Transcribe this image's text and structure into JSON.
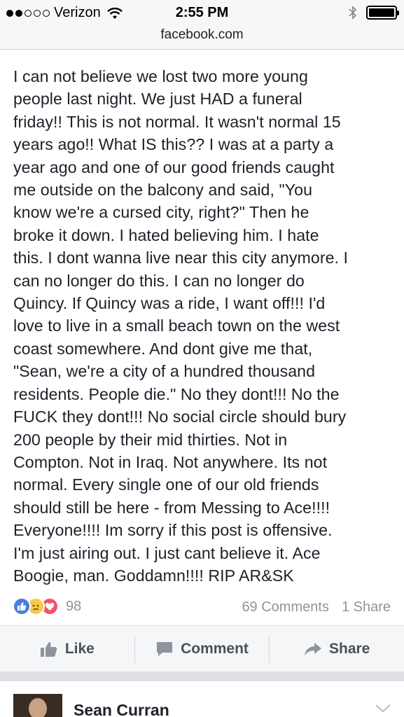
{
  "status_bar": {
    "carrier": "Verizon",
    "time": "2:55 PM",
    "signal_bars_filled": 2,
    "signal_bars_total": 5,
    "battery_level": 1.0
  },
  "browser": {
    "url": "facebook.com"
  },
  "post": {
    "text": "I can not believe we lost two more young\npeople last night. We just HAD a funeral\nfriday!! This is not normal. It wasn't normal 15\nyears ago!! What IS this?? I was at a party a\nyear ago and one of our good friends caught\nme outside on the balcony and said, \"You\nknow we're a cursed city, right?\" Then he\nbroke it down. I hated believing him. I hate\nthis. I dont wanna live near this city anymore. I\ncan no longer do this. I can no longer do\nQuincy. If Quincy was a ride, I want off!!! I'd\nlove to live in a small beach town on the west\ncoast somewhere. And dont give me that,\n\"Sean, we're a city of a hundred thousand\nresidents. People die.\" No they dont!!! No the\nFUCK they dont!!! No social circle should bury\n200 people by their mid thirties. Not in\nCompton. Not in Iraq. Not anywhere. Its not\nnormal. Every single one of our old friends\nshould still be here - from Messing to Ace!!!!\nEveryone!!!! Im sorry if this post is offensive.\nI'm just airing out. I just cant believe it. Ace\nBoogie, man. Goddamn!!!! RIP AR&SK",
    "reaction_icons": [
      "like-icon",
      "sad-icon",
      "love-icon"
    ],
    "reaction_count": "98",
    "comments": "69 Comments",
    "shares": "1 Share"
  },
  "actions": {
    "like": "Like",
    "comment": "Comment",
    "share": "Share"
  },
  "next_post": {
    "author": "Sean Curran"
  },
  "colors": {
    "like_blue": "#4a7de0",
    "sad_yellow": "#f7c948",
    "love_red": "#f25268",
    "meta_gray": "#90949c",
    "action_gray": "#4b4f56"
  }
}
